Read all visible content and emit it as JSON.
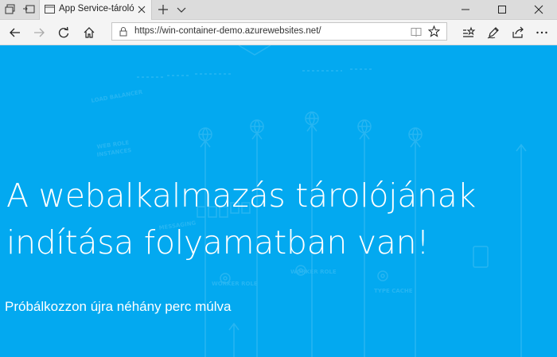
{
  "browser": {
    "tab": {
      "title": "App Service-tároló"
    },
    "address_bar": {
      "url": "https://win-container-demo.azurewebsites.net/"
    }
  },
  "page": {
    "headline_line1": "A webalkalmazás tárolójának",
    "headline_line2": "indítása folyamatban van!",
    "subtext": "Próbálkozzon újra néhány perc múlva",
    "background_color": "#03a9f0"
  },
  "colors": {
    "accent": "#03a9f0",
    "titlebar": "#dcdcdc",
    "toolbar": "#f4f4f4"
  },
  "icons": [
    "tab-list-icon",
    "set-aside-tabs-icon",
    "page-icon",
    "close-icon",
    "new-tab-icon",
    "tab-preview-icon",
    "minimize-icon",
    "maximize-icon",
    "window-close-icon",
    "back-icon",
    "forward-icon",
    "refresh-icon",
    "home-icon",
    "lock-icon",
    "reading-view-icon",
    "favorite-star-icon",
    "favorites-hub-icon",
    "pen-icon",
    "share-icon",
    "more-icon"
  ]
}
